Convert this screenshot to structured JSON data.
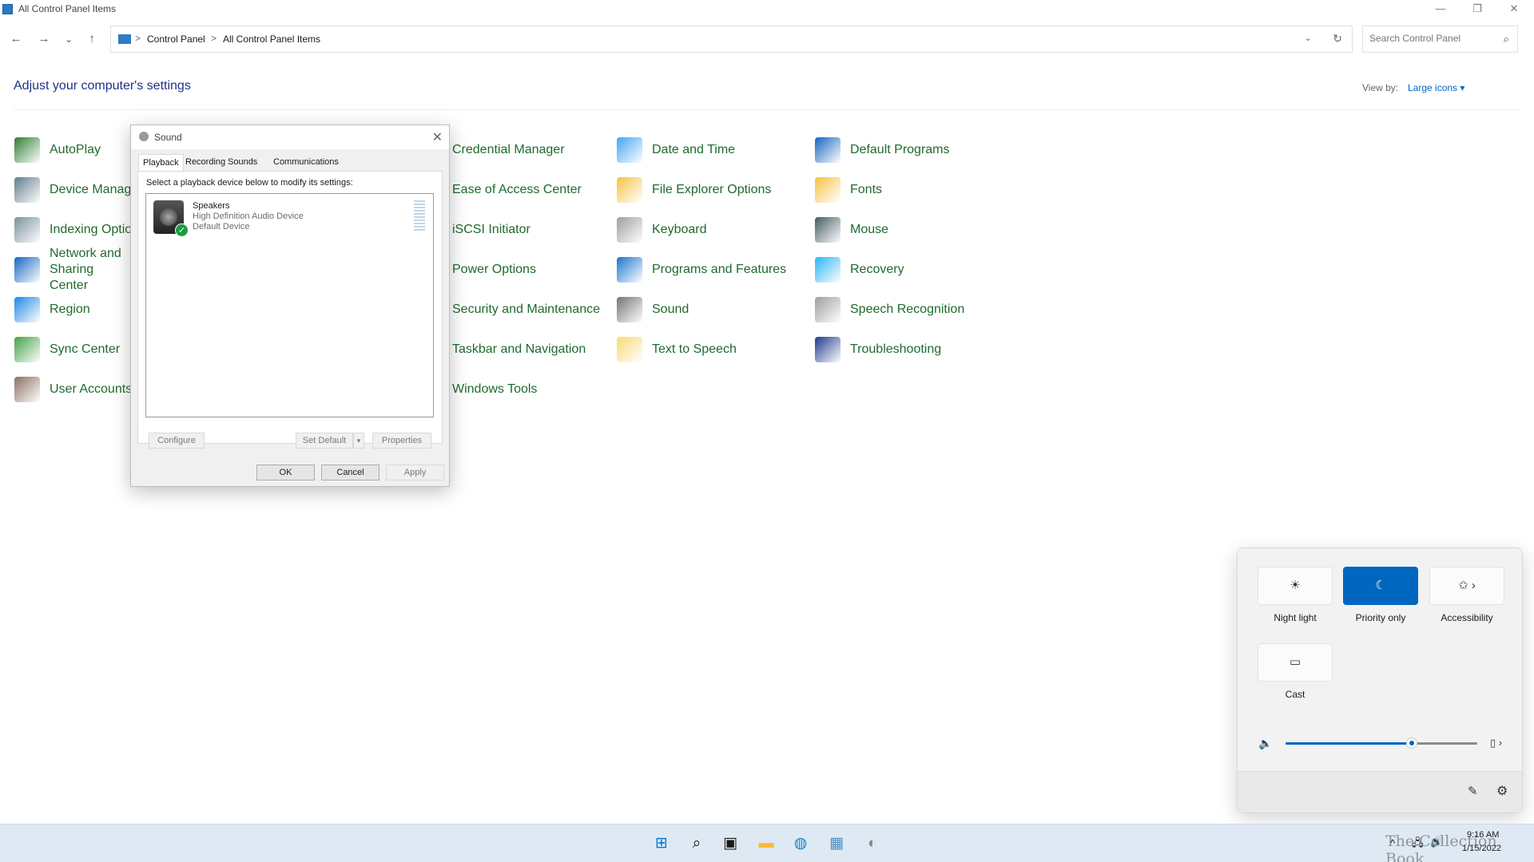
{
  "window": {
    "title": "All Control Panel Items",
    "controls": {
      "minimize": "—",
      "restore": "❐",
      "close": "✕"
    }
  },
  "nav": {
    "back": "←",
    "forward": "→",
    "recent": "⌄",
    "up": "↑",
    "breadcrumb": [
      "Control Panel",
      "All Control Panel Items"
    ],
    "breadcrumb_sep": ">",
    "dropdown": "⌄",
    "refresh": "↻",
    "search_placeholder": "Search Control Panel",
    "search_icon": "⌕"
  },
  "header": {
    "title": "Adjust your computer's settings",
    "view_by_label": "View by:",
    "view_by_value": "Large icons ▾"
  },
  "items": [
    {
      "label": "AutoPlay",
      "icon": "autoplay-icon",
      "color": "#2e7d32"
    },
    {
      "label": "Device Manager",
      "icon": "device-manager-icon",
      "color": "#607d8b"
    },
    {
      "label": "Indexing Options",
      "icon": "indexing-options-icon",
      "color": "#78909c"
    },
    {
      "label": "Network and Sharing Center",
      "icon": "network-icon",
      "color": "#1565c0"
    },
    {
      "label": "Region",
      "icon": "region-icon",
      "color": "#1e88e5"
    },
    {
      "label": "Sync Center",
      "icon": "sync-center-icon",
      "color": "#43a047"
    },
    {
      "label": "User Accounts",
      "icon": "user-accounts-icon",
      "color": "#8d6e63"
    },
    {
      "label": "Credential Manager",
      "icon": "credential-manager-icon",
      "color": "#f9a825"
    },
    {
      "label": "Ease of Access Center",
      "icon": "ease-of-access-icon",
      "color": "#1976d2"
    },
    {
      "label": "iSCSI Initiator",
      "icon": "iscsi-icon",
      "color": "#546e7a"
    },
    {
      "label": "Power Options",
      "icon": "power-options-icon",
      "color": "#2e7d32"
    },
    {
      "label": "Security and Maintenance",
      "icon": "security-icon",
      "color": "#1565c0"
    },
    {
      "label": "Taskbar and Navigation",
      "icon": "taskbar-icon",
      "color": "#455a64"
    },
    {
      "label": "Windows Tools",
      "icon": "windows-tools-icon",
      "color": "#607d8b"
    },
    {
      "label": "Date and Time",
      "icon": "date-time-icon",
      "color": "#42a5f5"
    },
    {
      "label": "File Explorer Options",
      "icon": "file-explorer-options-icon",
      "color": "#f6c342"
    },
    {
      "label": "Keyboard",
      "icon": "keyboard-icon",
      "color": "#9e9e9e"
    },
    {
      "label": "Programs and Features",
      "icon": "programs-icon",
      "color": "#1976d2"
    },
    {
      "label": "Sound",
      "icon": "sound-icon",
      "color": "#757575"
    },
    {
      "label": "Text to Speech",
      "icon": "text-to-speech-icon",
      "color": "#f9d976"
    },
    {
      "label": "Default Programs",
      "icon": "default-programs-icon",
      "color": "#1565c0"
    },
    {
      "label": "Fonts",
      "icon": "fonts-icon",
      "color": "#f6c342"
    },
    {
      "label": "Mouse",
      "icon": "mouse-icon",
      "color": "#455a64"
    },
    {
      "label": "Recovery",
      "icon": "recovery-icon",
      "color": "#29b6f6"
    },
    {
      "label": "Speech Recognition",
      "icon": "speech-recognition-icon",
      "color": "#9e9e9e"
    },
    {
      "label": "Troubleshooting",
      "icon": "troubleshooting-icon",
      "color": "#1e3a8a"
    }
  ],
  "sound_dialog": {
    "title": "Sound",
    "close": "✕",
    "tabs": [
      "Playback",
      "Recording",
      "Sounds",
      "Communications"
    ],
    "active_tab": "Playback",
    "instruction": "Select a playback device below to modify its settings:",
    "device": {
      "name": "Speakers",
      "description": "High Definition Audio Device",
      "status": "Default Device",
      "check": "✓"
    },
    "buttons": {
      "configure": "Configure",
      "set_default": "Set Default",
      "set_default_arrow": "▾",
      "properties": "Properties",
      "ok": "OK",
      "cancel": "Cancel",
      "apply": "Apply"
    }
  },
  "quick_settings": {
    "tiles": [
      {
        "label": "Night light",
        "icon": "☀",
        "active": false
      },
      {
        "label": "Priority only",
        "icon": "☾",
        "active": true
      },
      {
        "label": "Accessibility",
        "icon": "✩  ›",
        "active": false
      },
      {
        "label": "Cast",
        "icon": "▭",
        "active": false
      }
    ],
    "volume_icon": "🔈",
    "volume_level": 0.66,
    "output_icon": "▯ ›",
    "edit_icon": "✎",
    "settings_icon": "⚙",
    "accent_color": "#0067c0"
  },
  "taskbar": {
    "apps": [
      {
        "name": "start",
        "glyph": "⊞",
        "color": "#0078d4"
      },
      {
        "name": "search",
        "glyph": "⌕",
        "color": "#1a1a1a"
      },
      {
        "name": "task-view",
        "glyph": "▣",
        "color": "#1a1a1a"
      },
      {
        "name": "file-explorer",
        "glyph": "▬",
        "color": "#f6b93b"
      },
      {
        "name": "edge",
        "glyph": "◍",
        "color": "#0a84c6"
      },
      {
        "name": "control-panel",
        "glyph": "▦",
        "color": "#4a90c2"
      },
      {
        "name": "sound",
        "glyph": "◐",
        "color": "#888888"
      }
    ],
    "tray": {
      "chevron": "^",
      "network": "🖧",
      "volume": "🔊",
      "time": "9:16 AM",
      "date": "1/15/2022"
    },
    "watermark": "The Collection Book"
  }
}
